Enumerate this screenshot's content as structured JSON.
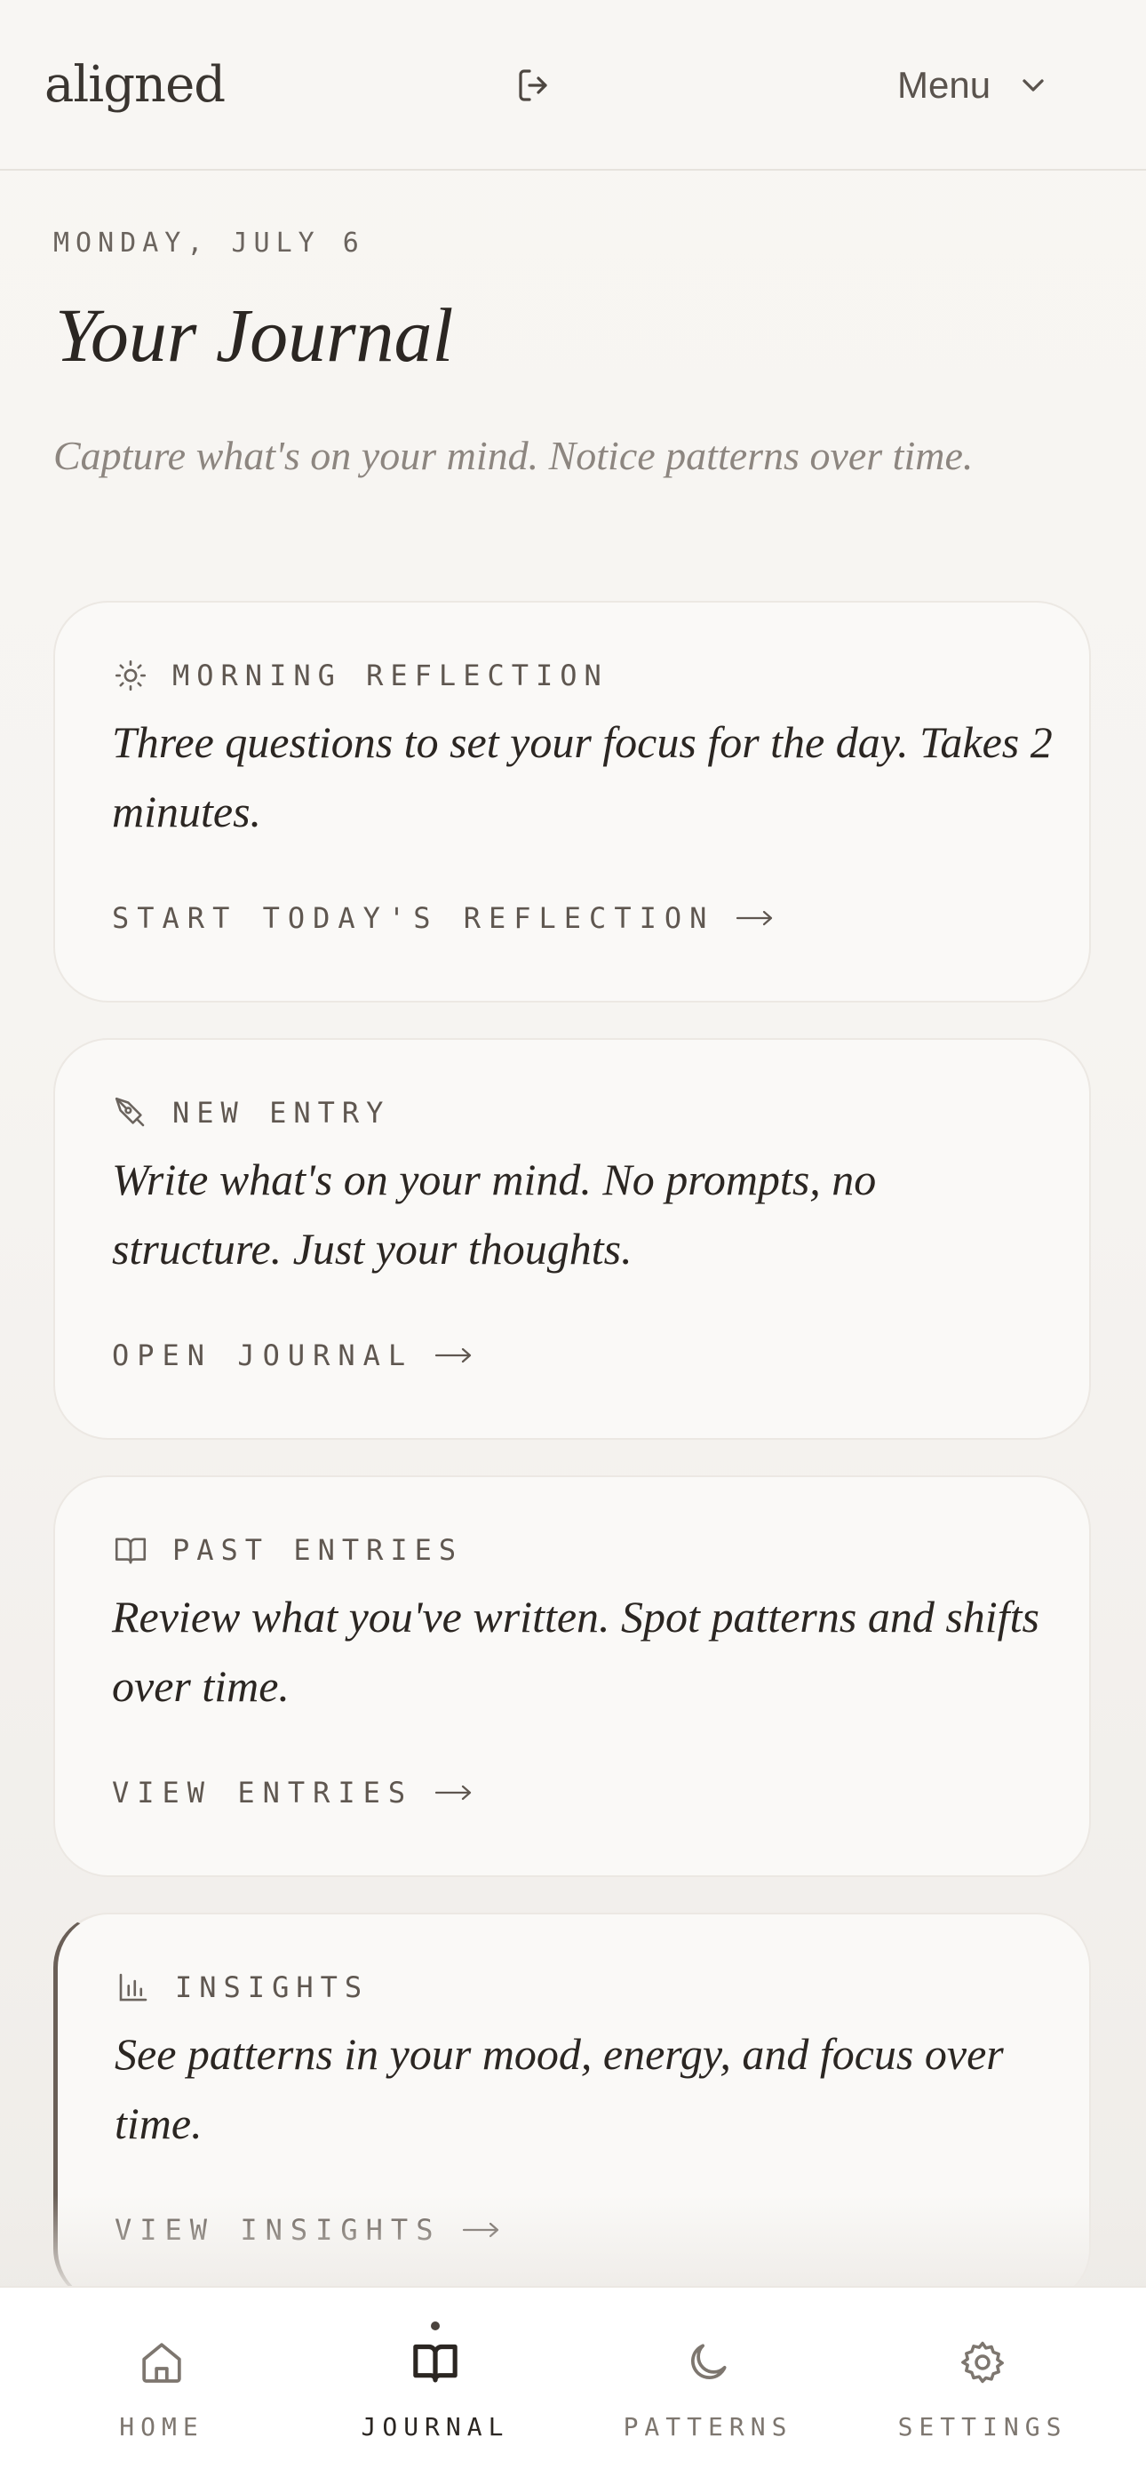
{
  "header": {
    "logo": "aligned",
    "menu_label": "Menu",
    "logout_icon": "logout-icon",
    "menu_icon": "chevron-down-icon"
  },
  "intro": {
    "date": "MONDAY, JULY 6",
    "title": "Your Journal",
    "subtitle": "Capture what's on your mind. Notice patterns over time."
  },
  "cards": [
    {
      "icon": "sun-icon",
      "label": "MORNING REFLECTION",
      "description": "Three questions to set your focus for the day. Takes 2 minutes.",
      "action": "START TODAY'S REFLECTION"
    },
    {
      "icon": "pen-icon",
      "label": "NEW ENTRY",
      "description": "Write what's on your mind. No prompts, no structure. Just your thoughts.",
      "action": "OPEN JOURNAL"
    },
    {
      "icon": "book-icon",
      "label": "PAST ENTRIES",
      "description": "Review what you've written. Spot patterns and shifts over time.",
      "action": "VIEW ENTRIES"
    },
    {
      "icon": "chart-icon",
      "label": "INSIGHTS",
      "description": "See patterns in your mood, energy, and focus over time.",
      "action": "VIEW INSIGHTS"
    }
  ],
  "nav": {
    "active": "JOURNAL",
    "items": [
      {
        "label": "HOME",
        "icon": "home-icon"
      },
      {
        "label": "JOURNAL",
        "icon": "book-open-icon"
      },
      {
        "label": "PATTERNS",
        "icon": "moon-icon"
      },
      {
        "label": "SETTINGS",
        "icon": "gear-icon"
      }
    ]
  },
  "colors": {
    "background": "#f7f5f2",
    "card": "#faf9f7",
    "text": "#2b2622",
    "muted": "#8d8680",
    "accent_border": "#6a5f57"
  }
}
